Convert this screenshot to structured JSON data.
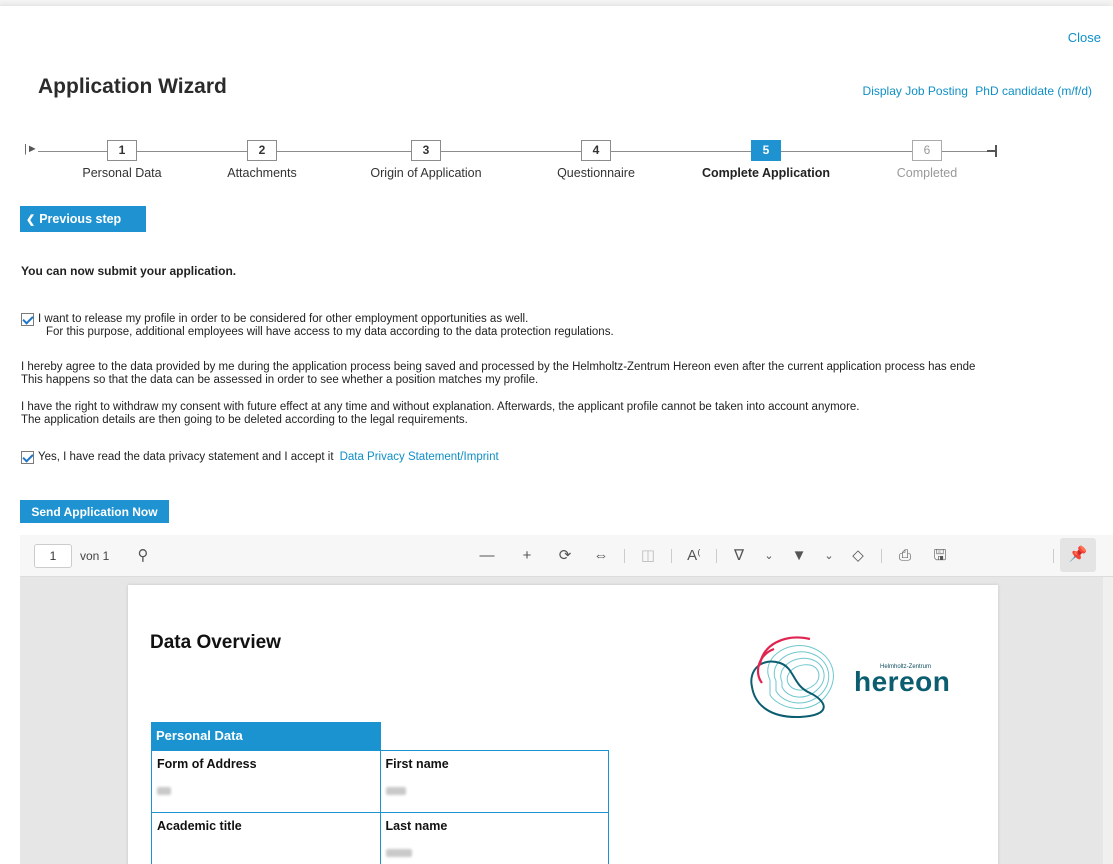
{
  "header": {
    "close_label": "Close",
    "title": "Application Wizard",
    "job_posting_link": "Display Job Posting",
    "job_title": "PhD candidate (m/f/d)"
  },
  "stepper": {
    "steps": [
      {
        "number": "1",
        "label": "Personal Data",
        "state": "done"
      },
      {
        "number": "2",
        "label": "Attachments",
        "state": "done"
      },
      {
        "number": "3",
        "label": "Origin of Application",
        "state": "done"
      },
      {
        "number": "4",
        "label": "Questionnaire",
        "state": "done"
      },
      {
        "number": "5",
        "label": "Complete Application",
        "state": "active"
      },
      {
        "number": "6",
        "label": "Completed",
        "state": "disabled"
      }
    ]
  },
  "prev_step_label": "Previous step",
  "submit_message": "You can now submit your application.",
  "release": {
    "checked": true,
    "line1": "I want to release my profile in order to be considered for other employment opportunities as well.",
    "line2": "For this purpose, additional employees will have access to my data according to the data protection regulations."
  },
  "consent": {
    "line1": "I hereby agree to the data provided by me during the application process being saved and processed by the Helmholtz-Zentrum Hereon even after the current application process has ende",
    "line2": "This happens so that the data can be assessed in order to see whether a position matches my profile."
  },
  "withdraw": {
    "line1": "I have the right to withdraw my consent with future effect at any time and without explanation. Afterwards, the applicant profile cannot be taken into account anymore.",
    "line2": "The application details are then going to be deleted according to the legal requirements."
  },
  "privacy": {
    "checked": true,
    "text": "Yes, I have read the data privacy statement and I accept it",
    "link": "Data Privacy Statement/Imprint"
  },
  "send_button_label": "Send Application Now",
  "pdf_viewer": {
    "page_number": "1",
    "page_of": "von 1",
    "document": {
      "title": "Data Overview",
      "logo_small_text": "Helmholtz-Zentrum",
      "logo_word": "hereon",
      "section_title": "Personal Data",
      "fields": [
        [
          "Form of Address",
          "First name"
        ],
        [
          "Academic title",
          "Last name"
        ]
      ]
    }
  },
  "colors": {
    "accent": "#1f93d2",
    "link": "#0f8fc6",
    "logo_teal": "#0b5d70",
    "logo_red": "#e0234f"
  }
}
